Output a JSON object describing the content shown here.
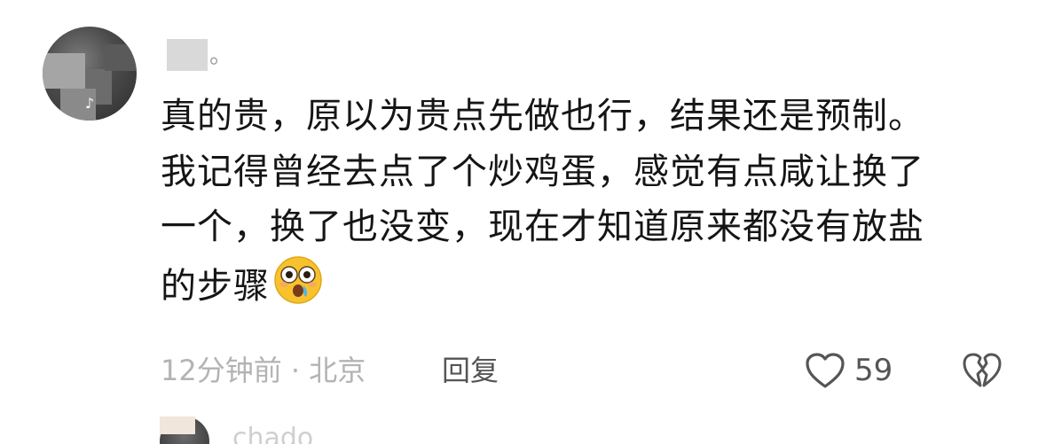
{
  "comment": {
    "username": "。",
    "content_lines": [
      "真的贵，原以为贵点先做也行，结果还是预制。",
      "我记得曾经去点了个炒鸡蛋，感觉有点咸让换了",
      "一个，换了也没变，现在才知道原来都没有放盐",
      "的步骤"
    ],
    "emoji": "flushed-crying-face",
    "meta": "12分钟前 · 北京",
    "reply_label": "回复",
    "like_count": "59",
    "like_icon": "heart-outline-icon",
    "dislike_icon": "broken-heart-icon",
    "avatar_badge_icon": "tiktok-icon"
  },
  "next_comment": {
    "username": "chado"
  },
  "colors": {
    "text": "#151515",
    "meta": "#b3b3b3",
    "action": "#555555"
  }
}
